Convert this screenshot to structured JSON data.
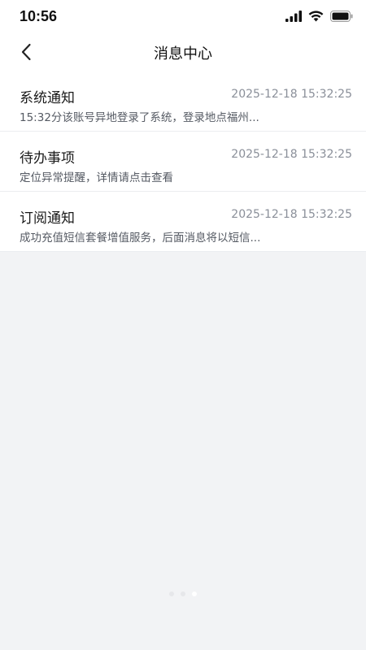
{
  "status_bar": {
    "time": "10:56"
  },
  "header": {
    "title": "消息中心",
    "back_icon": "chevron-left-icon"
  },
  "messages": [
    {
      "title": "系统通知",
      "time": "2025-12-18 15:32:25",
      "preview": "15:32分该账号异地登录了系统，登录地点福州..."
    },
    {
      "title": "待办事项",
      "time": "2025-12-18 15:32:25",
      "preview": "定位异常提醒，详情请点击查看"
    },
    {
      "title": "订阅通知",
      "time": "2025-12-18 15:32:25",
      "preview": "成功充值短信套餐增值服务，后面消息将以短信..."
    }
  ],
  "pager": {
    "count": 3,
    "active_index": 2
  },
  "colors": {
    "background": "#f2f3f5",
    "card": "#ffffff",
    "time_text": "#8a8f99",
    "preview_text": "#555a63"
  }
}
